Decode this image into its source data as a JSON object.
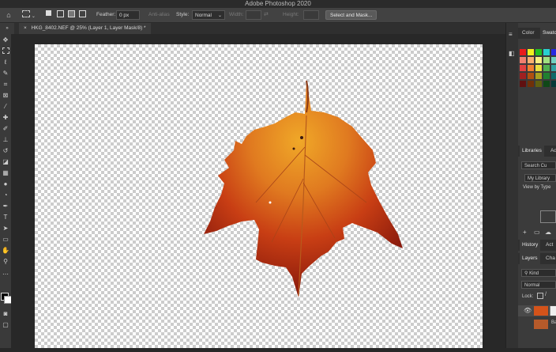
{
  "app": {
    "title": "Adobe Photoshop 2020"
  },
  "options_bar": {
    "feather_label": "Feather:",
    "feather_value": "0 px",
    "antialias_label": "Anti-alias",
    "style_label": "Style:",
    "style_value": "Normal",
    "width_label": "Width:",
    "height_label": "Height:",
    "select_mask_label": "Select and Mask..."
  },
  "document": {
    "tab_label": "HKG_8402.NEF @ 25% (Layer 1, Layer Mask/8) *"
  },
  "panels": {
    "color_tab": "Color",
    "swatches_tab": "Swatches",
    "libraries_tab": "Libraries",
    "adjustments_tab": "Ad",
    "libraries_search_placeholder": "Search Cu",
    "library_select": "My Library",
    "view_by": "View by Type",
    "history_tab": "History",
    "actions_tab": "Act",
    "layers_tab": "Layers",
    "channels_tab": "Cha",
    "kind_filter": "Kind",
    "blend_mode": "Normal",
    "lock_label": "Lock:",
    "layer2_name_partial": "Ba"
  },
  "colors": {
    "accent_leaf": "#d4531a",
    "swatches": [
      "#e81c1c",
      "#f0f020",
      "#22c022",
      "#28d0d0",
      "#2828e0",
      "#e020e0",
      "#ffffff",
      "#000000",
      "#f08070",
      "#f8b070",
      "#f8f080",
      "#a0e080",
      "#70d0c0",
      "#70a0e0",
      "#b080e0",
      "#e080c0",
      "#e04040",
      "#f08030",
      "#e8e040",
      "#50b050",
      "#30a0a0",
      "#3060c0",
      "#7040b0",
      "#c03080",
      "#a02020",
      "#b05010",
      "#a8a020",
      "#208030",
      "#106868",
      "#183880",
      "#402070",
      "#801850",
      "#601010",
      "#703008",
      "#606010",
      "#104818",
      "#083838",
      "#0c1c48",
      "#200c40",
      "#480c28"
    ]
  }
}
